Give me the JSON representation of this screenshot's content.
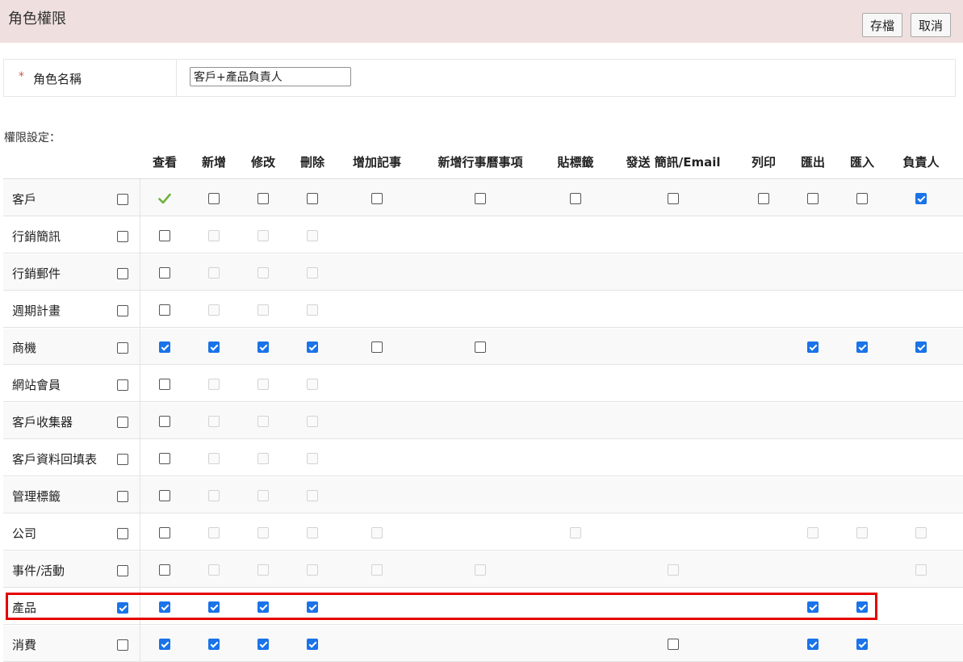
{
  "header": {
    "title": "角色權限",
    "save_label": "存檔",
    "cancel_label": "取消"
  },
  "role_name": {
    "required_mark": "*",
    "label": "角色名稱",
    "value": "客戶+產品負責人"
  },
  "permissions_label": "權限設定：",
  "columns": [
    "查看",
    "新增",
    "修改",
    "刪除",
    "增加記事",
    "新增行事曆事項",
    "貼標籤",
    "發送 簡訊/Email",
    "列印",
    "匯出",
    "匯入",
    "負責人"
  ],
  "rows": [
    {
      "label": "客戶",
      "all": "u",
      "cells": [
        "g",
        "u",
        "u",
        "u",
        "u",
        "u",
        "u",
        "u",
        "u",
        "u",
        "u",
        "c"
      ]
    },
    {
      "label": "行銷簡訊",
      "all": "u",
      "cells": [
        "u",
        "d",
        "d",
        "d",
        "",
        "",
        "",
        "",
        "",
        "",
        "",
        ""
      ]
    },
    {
      "label": "行銷郵件",
      "all": "u",
      "cells": [
        "u",
        "d",
        "d",
        "d",
        "",
        "",
        "",
        "",
        "",
        "",
        "",
        ""
      ]
    },
    {
      "label": "週期計畫",
      "all": "u",
      "cells": [
        "u",
        "d",
        "d",
        "d",
        "",
        "",
        "",
        "",
        "",
        "",
        "",
        ""
      ]
    },
    {
      "label": "商機",
      "all": "u",
      "cells": [
        "c",
        "c",
        "c",
        "c",
        "u",
        "u",
        "",
        "",
        "",
        "c",
        "c",
        "c"
      ]
    },
    {
      "label": "網站會員",
      "all": "u",
      "cells": [
        "u",
        "d",
        "d",
        "d",
        "",
        "",
        "",
        "",
        "",
        "",
        "",
        ""
      ]
    },
    {
      "label": "客戶收集器",
      "all": "u",
      "cells": [
        "u",
        "d",
        "d",
        "d",
        "",
        "",
        "",
        "",
        "",
        "",
        "",
        ""
      ]
    },
    {
      "label": "客戶資料回填表",
      "all": "u",
      "cells": [
        "u",
        "d",
        "d",
        "d",
        "",
        "",
        "",
        "",
        "",
        "",
        "",
        ""
      ]
    },
    {
      "label": "管理標籤",
      "all": "u",
      "cells": [
        "u",
        "d",
        "d",
        "d",
        "",
        "",
        "",
        "",
        "",
        "",
        "",
        ""
      ]
    },
    {
      "label": "公司",
      "all": "u",
      "cells": [
        "u",
        "d",
        "d",
        "d",
        "d",
        "",
        "d",
        "",
        "",
        "d",
        "d",
        "d"
      ]
    },
    {
      "label": "事件/活動",
      "all": "u",
      "cells": [
        "u",
        "d",
        "d",
        "d",
        "d",
        "d",
        "",
        "d",
        "",
        "",
        "",
        "d"
      ]
    },
    {
      "label": "產品",
      "all": "c",
      "cells": [
        "c",
        "c",
        "c",
        "c",
        "",
        "",
        "",
        "",
        "",
        "c",
        "c",
        ""
      ]
    },
    {
      "label": "消費",
      "all": "u",
      "cells": [
        "c",
        "c",
        "c",
        "c",
        "",
        "",
        "",
        "u",
        "",
        "c",
        "c",
        ""
      ]
    }
  ],
  "colors": {
    "header_bg": "#efe0df",
    "checkbox_checked": "#1a73e8",
    "highlight": "#e60000",
    "green_check": "#6db33f"
  }
}
